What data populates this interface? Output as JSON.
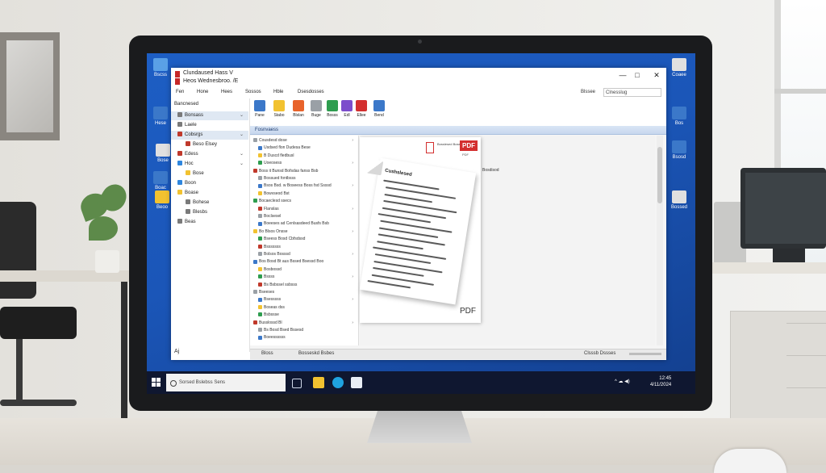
{
  "window": {
    "title": "Clundaused Hass V",
    "subtitle": "Heos Wednesbroo. /E",
    "controls": [
      "—",
      "□",
      "✕"
    ]
  },
  "menu": [
    "Fen",
    "Hone",
    "Hees",
    "Sossos",
    "Hble",
    "Dsesdosses"
  ],
  "search": {
    "label": "Blssee",
    "value": "Clnesslug"
  },
  "toolbar": [
    {
      "label": "Pane",
      "icon": "undo-icon",
      "color": "#3b78c9"
    },
    {
      "label": "Stabo",
      "icon": "highlighter-icon",
      "color": "#f2c230"
    },
    {
      "label": "Blslan",
      "icon": "palette-icon",
      "color": "#e8632b"
    },
    {
      "label": "Buge",
      "icon": "document-icon",
      "color": "#9aa0a6"
    },
    {
      "label": "Bosss",
      "icon": "bookmark-icon",
      "color": "#2e9d4f"
    },
    {
      "label": "Edl",
      "icon": "edit-icon",
      "color": "#7c4dcc"
    },
    {
      "label": "Ellee",
      "icon": "globe-icon",
      "color": "#d32f2f"
    },
    {
      "label": "Bend",
      "icon": "share-icon",
      "color": "#3b78c9"
    }
  ],
  "leftnav": {
    "header": "Bancnesed",
    "items": [
      {
        "label": "Bonsass",
        "color": "#7a7a7a",
        "selected": true
      },
      {
        "label": "Laele",
        "color": "#7a7a7a",
        "selected": false
      },
      {
        "label": "Cobsrgs",
        "color": "#c0392b",
        "selected": true
      },
      {
        "label": "Beso Elsey",
        "color": "#c0392b",
        "selected": false
      },
      {
        "label": "Edess",
        "color": "#c0392b",
        "selected": false
      },
      {
        "label": "Hoc",
        "color": "#2e86de",
        "selected": false
      },
      {
        "label": "Bose",
        "color": "#f2c230",
        "selected": false
      },
      {
        "label": "Boon",
        "color": "#2e86de",
        "selected": false
      },
      {
        "label": "Boase",
        "color": "#f2c230",
        "selected": false
      },
      {
        "label": "Bohese",
        "color": "#7a7a7a",
        "selected": false
      },
      {
        "label": "Blesbs",
        "color": "#7a7a7a",
        "selected": false
      },
      {
        "label": "Beas",
        "color": "#7a7a7a",
        "selected": false
      }
    ],
    "bottom": "Aj"
  },
  "pane_header": "Fosnvaess",
  "filelist": [
    "Cousdesd dose",
    "Usdsed flon Dudesa Bese",
    "B Duscd fledbusl",
    "Uoeosess",
    "Boss it Bunsd Bofsdas fanss Bsb",
    "Bossued fontbsss",
    "Bsos Bsd. w Boseess Boss fsd Ssssd",
    "Bowvseod Bst",
    "Bocaeclesd ssecs",
    "Flanslas",
    "Boclsesel",
    "Boeeses ad Cenlsasdeed Busfs Bsb",
    "Bo Blsos Onsse",
    "Bseess Bosd Cbfsdssd",
    "Bsssssss",
    "Bolsos Bosssd",
    "Bos Bosd Bt aus Bssed Bsessd Boo",
    "Bosbossd",
    "Bssss",
    "Bs Bsbssel ssbsss",
    "Bseeses",
    "Bsesssss",
    "Boseas dss",
    "Bsbssse",
    "Busslossd Bl",
    "Bs Bosd Bsed Bssesd",
    "Boeessssss"
  ],
  "preview": {
    "header_text": "Bosslesed Boseesd",
    "badge": "PDF",
    "badge_sub": "PDF",
    "side_text": "Bosdisod",
    "footer": "PDF",
    "sheet_title": "Cushslesed"
  },
  "status": {
    "left": "Bloss",
    "middle": "Bosseskd Bsbes",
    "right": "Clsssb Dssses"
  },
  "taskbar": {
    "search_placeholder": "Sorsed Bslebss Sens",
    "clock_time": "12:45",
    "clock_date": "4/11/2024",
    "tray": "^ ☁ ◀)"
  },
  "desktop_icons": [
    {
      "label": "Bscss",
      "color": "#5aa0e6"
    },
    {
      "label": "Hese",
      "color": "#3b78c9"
    },
    {
      "label": "Bose",
      "color": "#e0e0e0"
    },
    {
      "label": "Boac",
      "color": "#3b78c9"
    },
    {
      "label": "Beoo",
      "color": "#f2c230"
    },
    {
      "label": "Coaee",
      "color": "#e0e0e0"
    },
    {
      "label": "Bos",
      "color": "#3b78c9"
    },
    {
      "label": "Bsosd",
      "color": "#3b78c9"
    },
    {
      "label": "Bossed",
      "color": "#e0e0e0"
    }
  ]
}
